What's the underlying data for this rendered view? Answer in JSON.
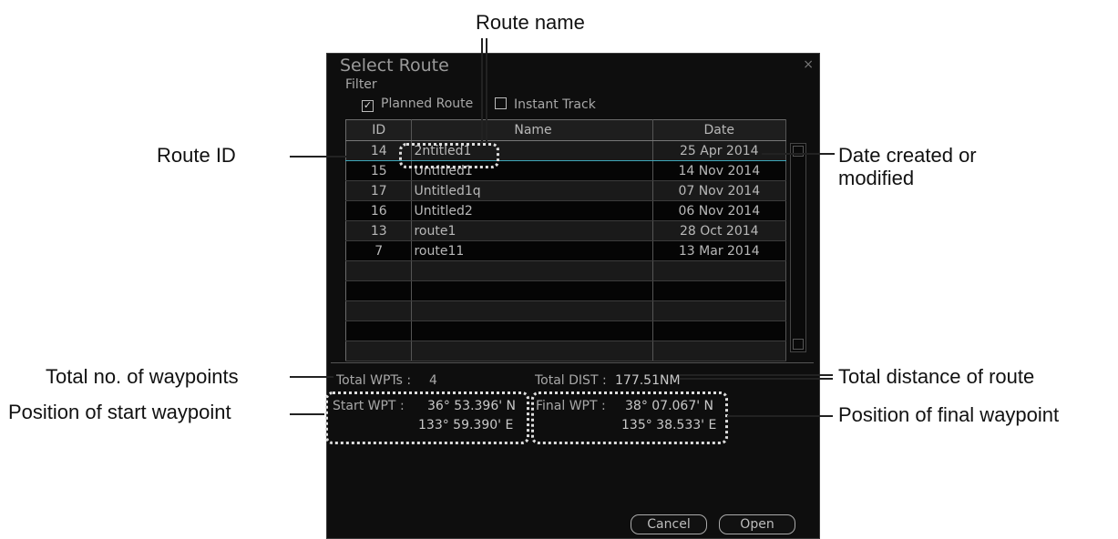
{
  "callouts": {
    "route_name": "Route name",
    "route_id": "Route ID",
    "date_created": "Date created or",
    "date_created_2": "modified",
    "total_wpts": "Total no. of waypoints",
    "total_dist": "Total distance of route",
    "start_pos": "Position of start waypoint",
    "final_pos": "Position of final waypoint"
  },
  "dialog": {
    "title": "Select Route",
    "close": "×",
    "filter_label": "Filter",
    "planned_route": "Planned Route",
    "instant_track": "Instant Track",
    "check_mark": "✓",
    "columns": {
      "id": "ID",
      "name": "Name",
      "date": "Date"
    },
    "routes": [
      {
        "id": "14",
        "name": "2ntitled1",
        "date": "25 Apr 2014"
      },
      {
        "id": "15",
        "name": "Untitled1",
        "date": "14 Nov 2014"
      },
      {
        "id": "17",
        "name": "Untitled1q",
        "date": "07 Nov 2014"
      },
      {
        "id": "16",
        "name": "Untitled2",
        "date": "06 Nov 2014"
      },
      {
        "id": "13",
        "name": "route1",
        "date": "28 Oct 2014"
      },
      {
        "id": "7",
        "name": "route11",
        "date": "13 Mar 2014"
      }
    ],
    "total_wpts_label": "Total WPTs :",
    "total_wpts_value": "4",
    "total_dist_label": "Total DIST :",
    "total_dist_value": "177.51NM",
    "start_wpt_label": "Start WPT :",
    "start_lat": "36° 53.396' N",
    "start_lon": "133° 59.390' E",
    "final_wpt_label": "Final WPT :",
    "final_lat": "38° 07.067' N",
    "final_lon": "135° 38.533' E",
    "cancel": "Cancel",
    "open": "Open"
  }
}
